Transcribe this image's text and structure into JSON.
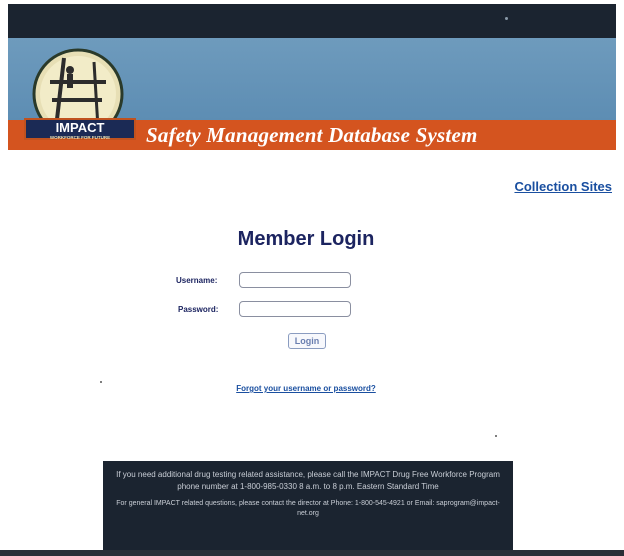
{
  "header": {
    "logo_text": "IMPACT",
    "logo_subtext": "WORKFORCE FOR FUTURE",
    "title": "Safety Management Database System"
  },
  "links": {
    "collection_sites": "Collection Sites",
    "forgot": "Forgot your username or password?"
  },
  "login": {
    "title": "Member Login",
    "username_label": "Username:",
    "password_label": "Password:",
    "username_value": "",
    "password_value": "",
    "button_label": "Login"
  },
  "footer": {
    "line1": "If you need additional drug testing related assistance, please call the IMPACT Drug Free Workforce Program phone number at 1-800-985-0330 8 a.m. to 8 p.m. Eastern Standard Time",
    "line2": "For general IMPACT related questions, please contact the director at Phone: 1-800-545-4921 or Email: saprogram@impact-net.org"
  },
  "colors": {
    "banner_blue": "#5d8db3",
    "banner_orange": "#d4541f",
    "navy_text": "#1c2460",
    "link_blue": "#1a4fa0",
    "dark_bar": "#1b2430"
  }
}
